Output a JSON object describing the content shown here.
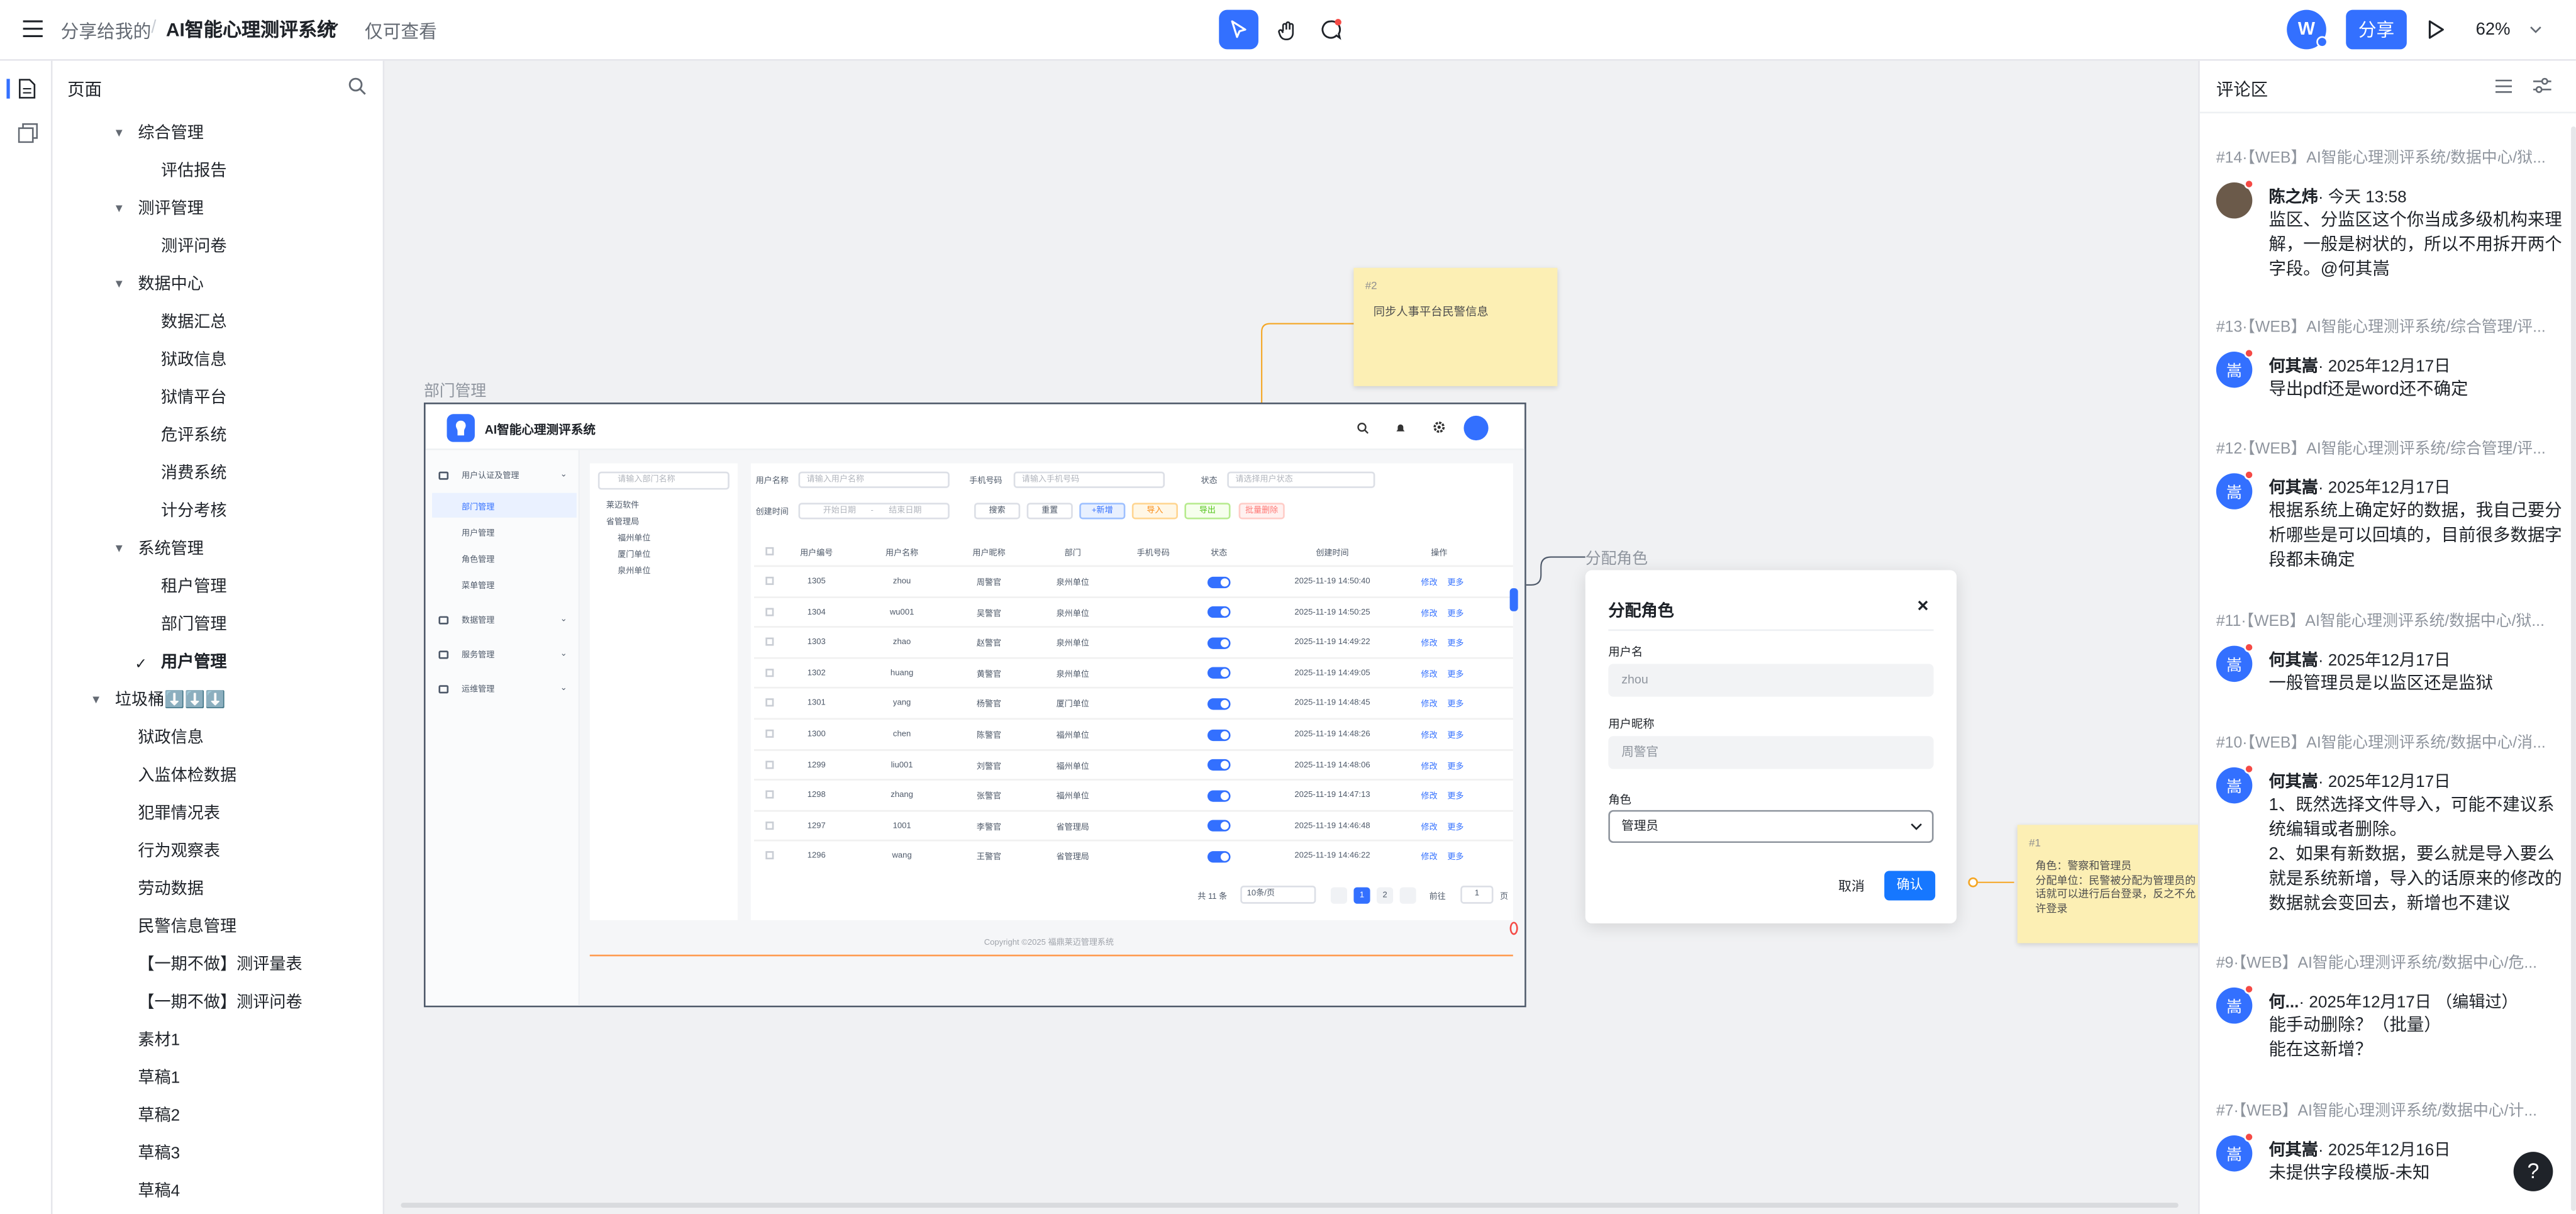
{
  "topbar": {
    "breadcrumb": "分享给我的",
    "separator": "/",
    "doc_title": "AI智能心理测评系统",
    "mode": "仅可查看",
    "avatar_letter": "W",
    "share_label": "分享",
    "zoom": "62%"
  },
  "tree": {
    "header": "页面",
    "items": [
      {
        "label": "综合管理",
        "expanded": true
      },
      {
        "label": "评估报告"
      },
      {
        "label": "测评管理",
        "expanded": true
      },
      {
        "label": "测评问卷"
      },
      {
        "label": "数据中心",
        "expanded": true
      },
      {
        "label": "数据汇总"
      },
      {
        "label": "狱政信息"
      },
      {
        "label": "狱情平台"
      },
      {
        "label": "危评系统"
      },
      {
        "label": "消费系统"
      },
      {
        "label": "计分考核"
      },
      {
        "label": "系统管理",
        "expanded": true
      },
      {
        "label": "租户管理"
      },
      {
        "label": "部门管理"
      },
      {
        "label": "用户管理",
        "selected": true
      },
      {
        "label": "垃圾桶⬇️⬇️⬇️",
        "expanded": true
      },
      {
        "label": "狱政信息"
      },
      {
        "label": "入监体检数据"
      },
      {
        "label": "犯罪情况表"
      },
      {
        "label": "行为观察表"
      },
      {
        "label": "劳动数据"
      },
      {
        "label": "民警信息管理"
      },
      {
        "label": "【一期不做】测评量表"
      },
      {
        "label": "【一期不做】测评问卷"
      },
      {
        "label": "素材1"
      },
      {
        "label": "草稿1"
      },
      {
        "label": "草稿2"
      },
      {
        "label": "草稿3"
      },
      {
        "label": "草稿4"
      }
    ]
  },
  "canvas": {
    "frame_label": "部门管理",
    "role_label": "分配角色",
    "sticky2": {
      "num": "#2",
      "text": "同步人事平台民警信息"
    },
    "sticky1": {
      "num": "#1",
      "line1": "角色：警察和管理员",
      "line2": "分配单位：民警被分配为管理员的",
      "line3": "话就可以进行后台登录，反之不允",
      "line4": "许登录"
    }
  },
  "app": {
    "title": "AI智能心理测评系统",
    "menu": [
      "用户认证及管理",
      "部门管理",
      "用户管理",
      "角色管理",
      "菜单管理",
      "数据管理",
      "服务管理",
      "运维管理"
    ],
    "dept_search_placeholder": "请输入部门名称",
    "dept_tree": [
      "莱迈软件",
      "省管理局",
      "福州单位",
      "厦门单位",
      "泉州单位"
    ],
    "filters": {
      "username_label": "用户名称",
      "username_ph": "请输入用户名称",
      "phone_label": "手机号码",
      "phone_ph": "请输入手机号码",
      "status_label": "状态",
      "status_ph": "请选择用户状态",
      "time_label": "创建时间",
      "start_ph": "开始日期",
      "end_ph": "结束日期"
    },
    "buttons": [
      "搜索",
      "重置",
      "+新增",
      "导入",
      "导出",
      "批量删除"
    ],
    "columns": [
      "用户编号",
      "用户名称",
      "用户昵称",
      "部门",
      "手机号码",
      "状态",
      "创建时间",
      "操作"
    ],
    "rows": [
      [
        "1305",
        "zhou",
        "周警官",
        "泉州单位",
        "",
        "2025-11-19 14:50:40"
      ],
      [
        "1304",
        "wu001",
        "吴警官",
        "泉州单位",
        "",
        "2025-11-19 14:50:25"
      ],
      [
        "1303",
        "zhao",
        "赵警官",
        "泉州单位",
        "",
        "2025-11-19 14:49:22"
      ],
      [
        "1302",
        "huang",
        "黄警官",
        "泉州单位",
        "",
        "2025-11-19 14:49:05"
      ],
      [
        "1301",
        "yang",
        "杨警官",
        "厦门单位",
        "",
        "2025-11-19 14:48:45"
      ],
      [
        "1300",
        "chen",
        "陈警官",
        "福州单位",
        "",
        "2025-11-19 14:48:26"
      ],
      [
        "1299",
        "liu001",
        "刘警官",
        "福州单位",
        "",
        "2025-11-19 14:48:06"
      ],
      [
        "1298",
        "zhang",
        "张警官",
        "福州单位",
        "",
        "2025-11-19 14:47:13"
      ],
      [
        "1297",
        "1001",
        "李警官",
        "省管理局",
        "",
        "2025-11-19 14:46:48"
      ],
      [
        "1296",
        "wang",
        "王警官",
        "省管理局",
        "",
        "2025-11-19 14:46:22"
      ]
    ],
    "row_action_edit": "修改",
    "row_action_more": "更多",
    "pager": {
      "total": "共 11 条",
      "size": "10条/页",
      "page1": "1",
      "page2": "2",
      "goto": "前往",
      "page_input": "1",
      "page_suffix": "页"
    },
    "footer": "Copyright ©2025 福鼎莱迈管理系统"
  },
  "dialog": {
    "title": "分配角色",
    "username_label": "用户名",
    "username_value": "zhou",
    "nickname_label": "用户昵称",
    "nickname_value": "周警官",
    "role_label": "角色",
    "role_value": "管理员",
    "cancel": "取消",
    "confirm": "确认"
  },
  "comments": {
    "header": "评论区",
    "items": [
      {
        "ref": "#14·【WEB】AI智能心理测评系统/数据中心/狱...",
        "avatar": "",
        "author": "陈之炜",
        "time": "· 今天 13:58",
        "body": "监区、分监区这个你当成多级机构来理解，一般是树状的，所以不用拆开两个字段。@何其嵩"
      },
      {
        "ref": "#13·【WEB】AI智能心理测评系统/综合管理/评...",
        "avatar": "嵩",
        "author": "何其嵩",
        "time": "· 2025年12月17日",
        "body": "导出pdf还是word还不确定"
      },
      {
        "ref": "#12·【WEB】AI智能心理测评系统/综合管理/评...",
        "avatar": "嵩",
        "author": "何其嵩",
        "time": "· 2025年12月17日",
        "body": "根据系统上确定好的数据，我自己要分析哪些是可以回填的，目前很多数据字段都未确定"
      },
      {
        "ref": "#11·【WEB】AI智能心理测评系统/数据中心/狱...",
        "avatar": "嵩",
        "author": "何其嵩",
        "time": "· 2025年12月17日",
        "body": "一般管理员是以监区还是监狱"
      },
      {
        "ref": "#10·【WEB】AI智能心理测评系统/数据中心/消...",
        "avatar": "嵩",
        "author": "何其嵩",
        "time": "· 2025年12月17日",
        "body": "1、既然选择文件导入，可能不建议系统编辑或者删除。\n2、如果有新数据，要么就是导入要么就是系统新增，导入的话原来的修改的数据就会变回去，新增也不建议"
      },
      {
        "ref": "#9·【WEB】AI智能心理测评系统/数据中心/危...",
        "avatar": "嵩",
        "author": "何...",
        "time": "· 2025年12月17日 （编辑过）",
        "body": "能手动删除？（批量）\n能在这新增？"
      },
      {
        "ref": "#7·【WEB】AI智能心理测评系统/数据中心/计...",
        "avatar": "嵩",
        "author": "何其嵩",
        "time": "· 2025年12月16日",
        "body": "未提供字段模版-未知"
      }
    ]
  },
  "help_label": "?"
}
